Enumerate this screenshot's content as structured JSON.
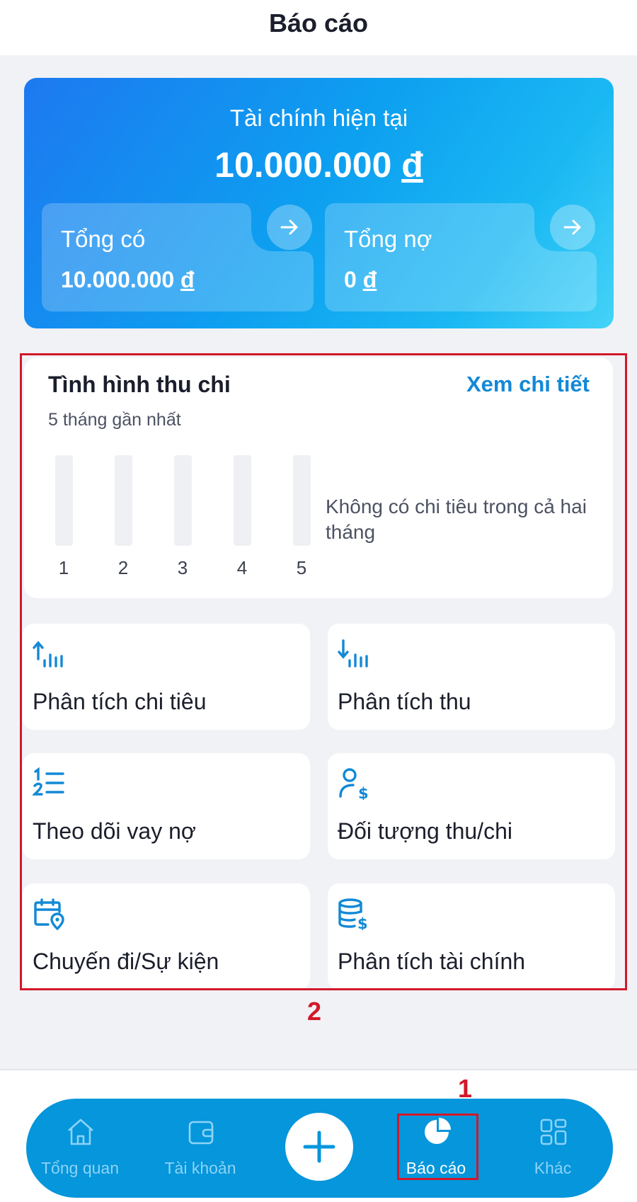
{
  "header": {
    "title": "Báo cáo"
  },
  "finance": {
    "label": "Tài chính hiện tại",
    "amount": "10.000.000",
    "currency": "đ",
    "total_assets": {
      "label": "Tổng có",
      "value": "10.000.000",
      "currency": "đ"
    },
    "total_debt": {
      "label": "Tổng nợ",
      "value": "0",
      "currency": "đ"
    }
  },
  "summary": {
    "title": "Tình hình thu chi",
    "link": "Xem chi tiết",
    "subtitle": "5 tháng gần nhất",
    "bars": [
      "1",
      "2",
      "3",
      "4",
      "5"
    ],
    "empty_message": "Không có chi tiêu trong cả hai tháng"
  },
  "tiles": [
    {
      "label": "Phân tích chi tiêu",
      "icon": "expense-chart-icon"
    },
    {
      "label": "Phân tích thu",
      "icon": "income-chart-icon"
    },
    {
      "label": "Theo dõi vay nợ",
      "icon": "numbered-list-icon"
    },
    {
      "label": "Đối tượng thu/chi",
      "icon": "person-dollar-icon"
    },
    {
      "label": "Chuyến đi/Sự kiện",
      "icon": "calendar-location-icon"
    },
    {
      "label": "Phân tích tài chính",
      "icon": "database-dollar-icon"
    }
  ],
  "annotations": {
    "marker_1": "1",
    "marker_2": "2"
  },
  "nav": {
    "items": [
      {
        "label": "Tổng quan",
        "icon": "home-icon"
      },
      {
        "label": "Tài khoản",
        "icon": "wallet-icon"
      },
      {
        "label": "Báo cáo",
        "icon": "pie-chart-icon"
      },
      {
        "label": "Khác",
        "icon": "grid-icon"
      }
    ],
    "active": "Báo cáo",
    "add_icon": "plus-icon"
  },
  "colors": {
    "accent": "#1289d6",
    "nav_background": "#0596db",
    "highlight": "#d3182a",
    "card_gradient_start": "#1d79f0",
    "card_gradient_end": "#45d3f7"
  }
}
